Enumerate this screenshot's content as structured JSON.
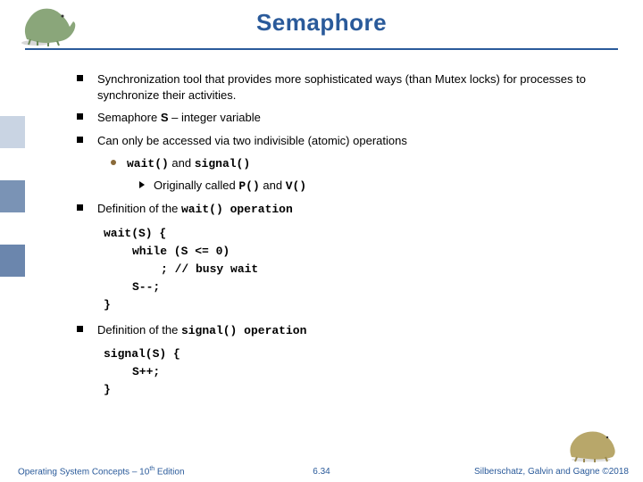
{
  "title": "Semaphore",
  "bullets": {
    "b1": "Synchronization tool that provides more sophisticated ways (than Mutex locks)  for processes to synchronize their activities.",
    "b2_pre": "Semaphore ",
    "b2_var": "S",
    "b2_post": " – integer variable",
    "b3": "Can only be accessed via two indivisible (atomic) operations",
    "s1_a": "wait()",
    "s1_mid": " and ",
    "s1_b": "signal()",
    "s2_pre": "Originally called ",
    "s2_a": "P()",
    "s2_mid": " and ",
    "s2_b": "V()",
    "b4_pre": "Definition of  the ",
    "b4_op": "wait()",
    "b4_post": " operation",
    "b5_pre": "Definition of  the ",
    "b5_op": "signal() operation"
  },
  "code_wait": {
    "l1": "wait(S) {",
    "l2": "while (S <= 0)",
    "l3": "; // busy wait",
    "l4": "S--;",
    "l5": "}"
  },
  "code_signal": {
    "l1": "signal(S) {",
    "l2": "S++;",
    "l5": "}"
  },
  "footer": {
    "left_a": "Operating System Concepts – 10",
    "left_b": " Edition",
    "center": "6.34",
    "right": "Silberschatz, Galvin and Gagne ©2018"
  }
}
